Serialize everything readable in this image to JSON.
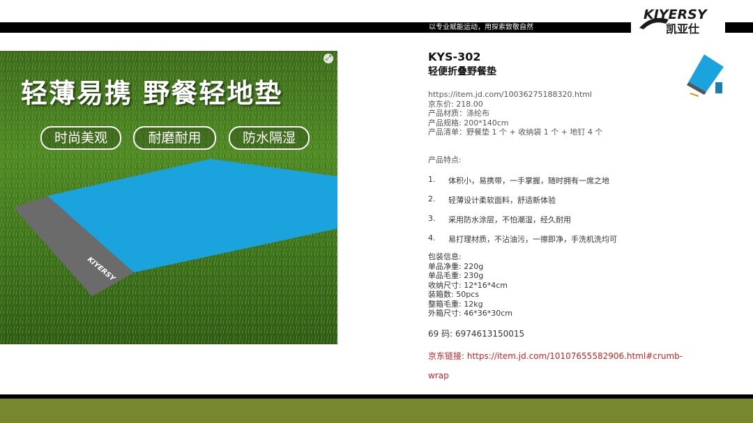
{
  "header": {
    "slogan": "以专业赋能运动，用探索致敬自然",
    "logo_text": "KIYERSY",
    "logo_cn": "凯亚仕"
  },
  "banner": {
    "headline": "轻薄易携 野餐轻地垫",
    "tags": [
      "时尚美观",
      "耐磨耐用",
      "防水隔湿"
    ],
    "mat_logo": "KIYERSY"
  },
  "product": {
    "model": "KYS-302",
    "name": "轻便折叠野餐垫",
    "url": "https://item.jd.com/10036275188320.html",
    "price": "京东价:   218.00",
    "material": "产品材质：涤纶布",
    "size": "产品规格:   200*140cm",
    "contents": "产品清单：野餐垫 1 个 + 收纳袋 1 个 + 地钉 4 个"
  },
  "features": {
    "heading": "产品特点:",
    "items": [
      {
        "num": "1.",
        "text": "体积小，易携带，一手掌握，随时拥有一席之地"
      },
      {
        "num": "2.",
        "text": "轻薄设计柔软面料，舒适新体验"
      },
      {
        "num": "3.",
        "text": "采用防水涂层，不怕潮湿，经久耐用"
      },
      {
        "num": "4.",
        "text": "易打理材质，不沾油污，一擦即净，手洗机洗均可"
      }
    ]
  },
  "packing": {
    "heading": "包装信息:",
    "net_weight": "单品净重:   220g",
    "gross_weight": "单品毛重:   230g",
    "storage_size": "收纳尺寸:   12*16*4cm",
    "carton_qty": "装箱数:   50pcs",
    "carton_weight": "整箱毛重:    12kg",
    "carton_size": "外箱尺寸:   46*36*30cm"
  },
  "barcode": "69 码:   6974613150015",
  "jd_link": "京东链接:   https://item.jd.com/10107655582906.html#crumb-wrap",
  "colors": {
    "accent_green": "#76872d",
    "link_red": "#d42020",
    "mat_blue": "#1aa3dc",
    "mat_gray": "#6b6b6b"
  }
}
